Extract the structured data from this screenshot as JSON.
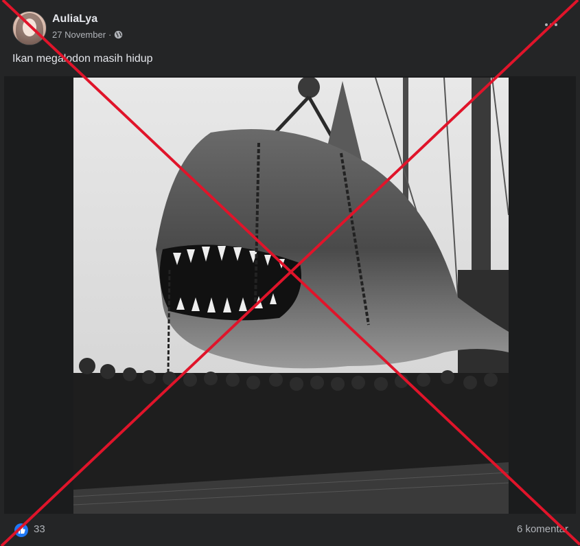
{
  "post": {
    "author": "AuliaLya",
    "date": "27 November",
    "separator": "·",
    "caption": "Ikan megalodon masih hidup",
    "privacy_icon": "globe-icon",
    "more_icon": "more-options-icon"
  },
  "footer": {
    "reaction_icon": "like-icon",
    "reaction_count": "33",
    "comments_label": "6 komentar"
  },
  "overlay": {
    "mark": "red-x-overlay",
    "color": "#e0142a"
  },
  "photo": {
    "description_icon": "shark-photo"
  }
}
